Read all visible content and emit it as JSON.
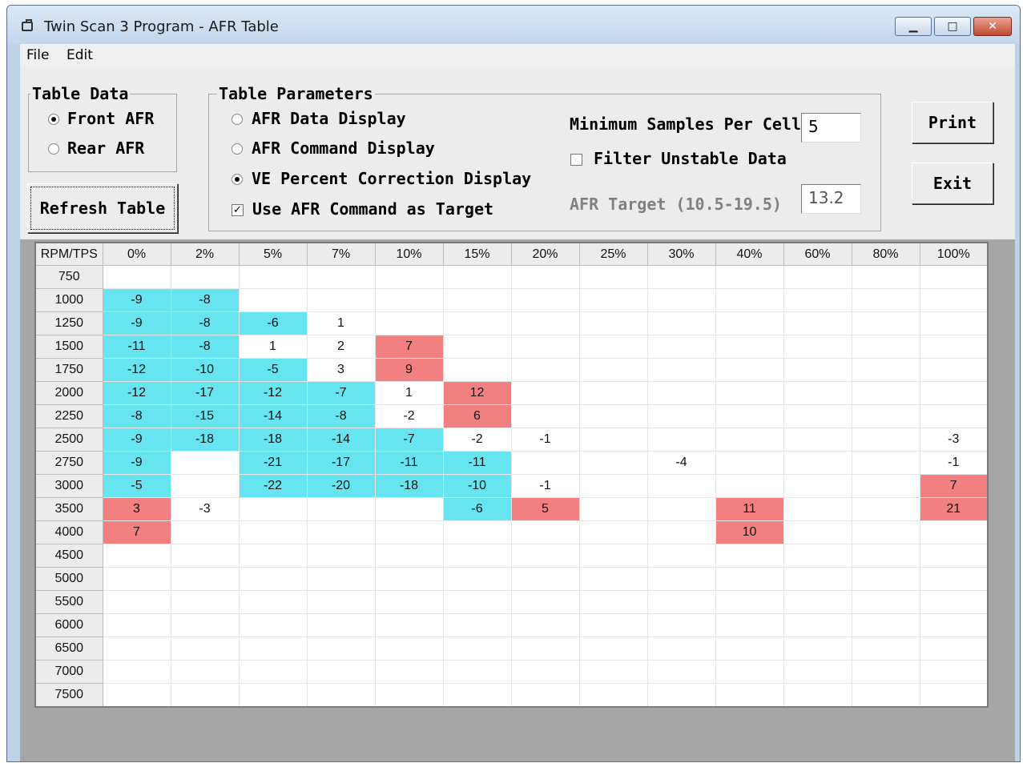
{
  "window": {
    "title": "Twin Scan 3 Program - AFR Table"
  },
  "menu": {
    "file": "File",
    "edit": "Edit"
  },
  "table_data": {
    "legend": "Table Data",
    "front": "Front AFR",
    "rear": "Rear AFR",
    "selected": "front"
  },
  "refresh_label": "Refresh Table",
  "table_params": {
    "legend": "Table Parameters",
    "afr_data": "AFR Data Display",
    "afr_command": "AFR Command Display",
    "ve_percent": "VE Percent Correction Display",
    "selected": "ve_percent",
    "use_cmd_target": "Use AFR Command as Target",
    "use_cmd_target_checked": true,
    "min_samples_label": "Minimum Samples Per Cell",
    "min_samples_value": "5",
    "filter_unstable": "Filter Unstable Data",
    "filter_unstable_checked": false,
    "afr_target_label": "AFR Target (10.5-19.5)",
    "afr_target_value": "13.2"
  },
  "print_label": "Print",
  "exit_label": "Exit",
  "colors": {
    "negative": "#66e4ef",
    "positive": "#f38080"
  },
  "grid": {
    "corner": "RPM/TPS",
    "columns": [
      "0%",
      "2%",
      "5%",
      "7%",
      "10%",
      "15%",
      "20%",
      "25%",
      "30%",
      "40%",
      "60%",
      "80%",
      "100%"
    ],
    "rows": [
      {
        "rpm": "750",
        "cells": [
          "",
          "",
          "",
          "",
          "",
          "",
          "",
          "",
          "",
          "",
          "",
          "",
          ""
        ]
      },
      {
        "rpm": "1000",
        "cells": [
          "-9",
          "-8",
          "",
          "",
          "",
          "",
          "",
          "",
          "",
          "",
          "",
          "",
          ""
        ]
      },
      {
        "rpm": "1250",
        "cells": [
          "-9",
          "-8",
          "-6",
          "1",
          "",
          "",
          "",
          "",
          "",
          "",
          "",
          "",
          ""
        ]
      },
      {
        "rpm": "1500",
        "cells": [
          "-11",
          "-8",
          "1",
          "2",
          "7",
          "",
          "",
          "",
          "",
          "",
          "",
          "",
          ""
        ]
      },
      {
        "rpm": "1750",
        "cells": [
          "-12",
          "-10",
          "-5",
          "3",
          "9",
          "",
          "",
          "",
          "",
          "",
          "",
          "",
          ""
        ]
      },
      {
        "rpm": "2000",
        "cells": [
          "-12",
          "-17",
          "-12",
          "-7",
          "1",
          "12",
          "",
          "",
          "",
          "",
          "",
          "",
          ""
        ]
      },
      {
        "rpm": "2250",
        "cells": [
          "-8",
          "-15",
          "-14",
          "-8",
          "-2",
          "6",
          "",
          "",
          "",
          "",
          "",
          "",
          ""
        ]
      },
      {
        "rpm": "2500",
        "cells": [
          "-9",
          "-18",
          "-18",
          "-14",
          "-7",
          "-2",
          "-1",
          "",
          "",
          "",
          "",
          "",
          "-3"
        ]
      },
      {
        "rpm": "2750",
        "cells": [
          "-9",
          "",
          "-21",
          "-17",
          "-11",
          "-11",
          "",
          "",
          "-4",
          "",
          "",
          "",
          "-1"
        ]
      },
      {
        "rpm": "3000",
        "cells": [
          "-5",
          "",
          "-22",
          "-20",
          "-18",
          "-10",
          "-1",
          "",
          "",
          "",
          "",
          "",
          "7"
        ]
      },
      {
        "rpm": "3500",
        "cells": [
          "3",
          "-3",
          "",
          "",
          "",
          "-6",
          "5",
          "",
          "",
          "11",
          "",
          "",
          "21"
        ]
      },
      {
        "rpm": "4000",
        "cells": [
          "7",
          "",
          "",
          "",
          "",
          "",
          "",
          "",
          "",
          "10",
          "",
          "",
          ""
        ]
      },
      {
        "rpm": "4500",
        "cells": [
          "",
          "",
          "",
          "",
          "",
          "",
          "",
          "",
          "",
          "",
          "",
          "",
          ""
        ]
      },
      {
        "rpm": "5000",
        "cells": [
          "",
          "",
          "",
          "",
          "",
          "",
          "",
          "",
          "",
          "",
          "",
          "",
          ""
        ]
      },
      {
        "rpm": "5500",
        "cells": [
          "",
          "",
          "",
          "",
          "",
          "",
          "",
          "",
          "",
          "",
          "",
          "",
          ""
        ]
      },
      {
        "rpm": "6000",
        "cells": [
          "",
          "",
          "",
          "",
          "",
          "",
          "",
          "",
          "",
          "",
          "",
          "",
          ""
        ]
      },
      {
        "rpm": "6500",
        "cells": [
          "",
          "",
          "",
          "",
          "",
          "",
          "",
          "",
          "",
          "",
          "",
          "",
          ""
        ]
      },
      {
        "rpm": "7000",
        "cells": [
          "",
          "",
          "",
          "",
          "",
          "",
          "",
          "",
          "",
          "",
          "",
          "",
          ""
        ]
      },
      {
        "rpm": "7500",
        "cells": [
          "",
          "",
          "",
          "",
          "",
          "",
          "",
          "",
          "",
          "",
          "",
          "",
          ""
        ]
      }
    ],
    "highlight": [
      [
        "",
        "",
        "",
        "",
        "",
        "",
        "",
        "",
        "",
        "",
        "",
        "",
        ""
      ],
      [
        "b",
        "b",
        "",
        "",
        "",
        "",
        "",
        "",
        "",
        "",
        "",
        "",
        ""
      ],
      [
        "b",
        "b",
        "b",
        "",
        "",
        "",
        "",
        "",
        "",
        "",
        "",
        "",
        ""
      ],
      [
        "b",
        "b",
        "",
        "",
        "r",
        "",
        "",
        "",
        "",
        "",
        "",
        "",
        ""
      ],
      [
        "b",
        "b",
        "b",
        "",
        "r",
        "",
        "",
        "",
        "",
        "",
        "",
        "",
        ""
      ],
      [
        "b",
        "b",
        "b",
        "b",
        "",
        "r",
        "",
        "",
        "",
        "",
        "",
        "",
        ""
      ],
      [
        "b",
        "b",
        "b",
        "b",
        "",
        "r",
        "",
        "",
        "",
        "",
        "",
        "",
        ""
      ],
      [
        "b",
        "b",
        "b",
        "b",
        "b",
        "",
        "",
        "",
        "",
        "",
        "",
        "",
        ""
      ],
      [
        "b",
        "",
        "b",
        "b",
        "b",
        "b",
        "",
        "",
        "",
        "",
        "",
        "",
        ""
      ],
      [
        "b",
        "",
        "b",
        "b",
        "b",
        "b",
        "",
        "",
        "",
        "",
        "",
        "",
        "r"
      ],
      [
        "r",
        "",
        "",
        "",
        "",
        "b",
        "r",
        "",
        "",
        "r",
        "",
        "",
        "r"
      ],
      [
        "r",
        "",
        "",
        "",
        "",
        "",
        "",
        "",
        "",
        "r",
        "",
        "",
        ""
      ],
      [
        "",
        "",
        "",
        "",
        "",
        "",
        "",
        "",
        "",
        "",
        "",
        "",
        ""
      ],
      [
        "",
        "",
        "",
        "",
        "",
        "",
        "",
        "",
        "",
        "",
        "",
        "",
        ""
      ],
      [
        "",
        "",
        "",
        "",
        "",
        "",
        "",
        "",
        "",
        "",
        "",
        "",
        ""
      ],
      [
        "",
        "",
        "",
        "",
        "",
        "",
        "",
        "",
        "",
        "",
        "",
        "",
        ""
      ],
      [
        "",
        "",
        "",
        "",
        "",
        "",
        "",
        "",
        "",
        "",
        "",
        "",
        ""
      ],
      [
        "",
        "",
        "",
        "",
        "",
        "",
        "",
        "",
        "",
        "",
        "",
        "",
        ""
      ],
      [
        "",
        "",
        "",
        "",
        "",
        "",
        "",
        "",
        "",
        "",
        "",
        "",
        ""
      ]
    ]
  }
}
